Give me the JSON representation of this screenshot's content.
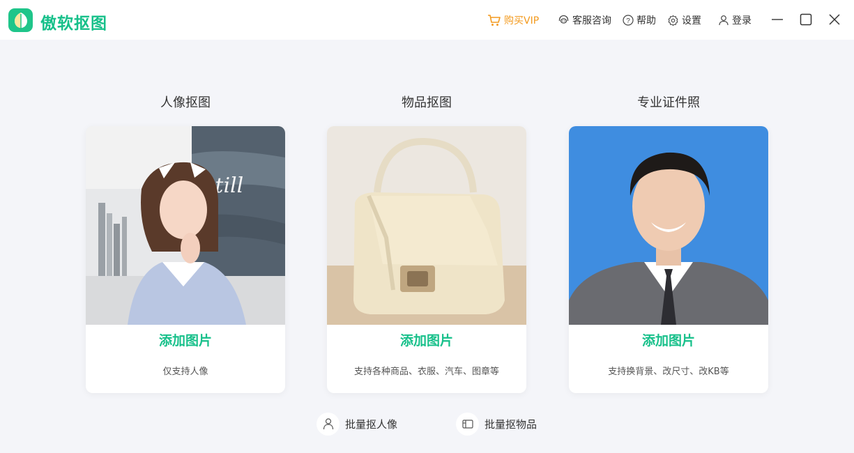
{
  "app": {
    "title": "傲软抠图"
  },
  "toolbar": {
    "buy_vip": "购买VIP",
    "support": "客服咨询",
    "help": "帮助",
    "settings": "设置",
    "login": "登录"
  },
  "colors": {
    "accent": "#17c08a",
    "vip": "#f39a1e",
    "id_photo_bg": "#3f8de0"
  },
  "cards": [
    {
      "title": "人像抠图",
      "action": "添加图片",
      "desc": "仅支持人像"
    },
    {
      "title": "物品抠图",
      "action": "添加图片",
      "desc": "支持各种商品、衣服、汽车、图章等"
    },
    {
      "title": "专业证件照",
      "action": "添加图片",
      "desc": "支持换背景、改尺寸、改KB等"
    }
  ],
  "batch": {
    "portrait": "批量抠人像",
    "object": "批量抠物品"
  }
}
